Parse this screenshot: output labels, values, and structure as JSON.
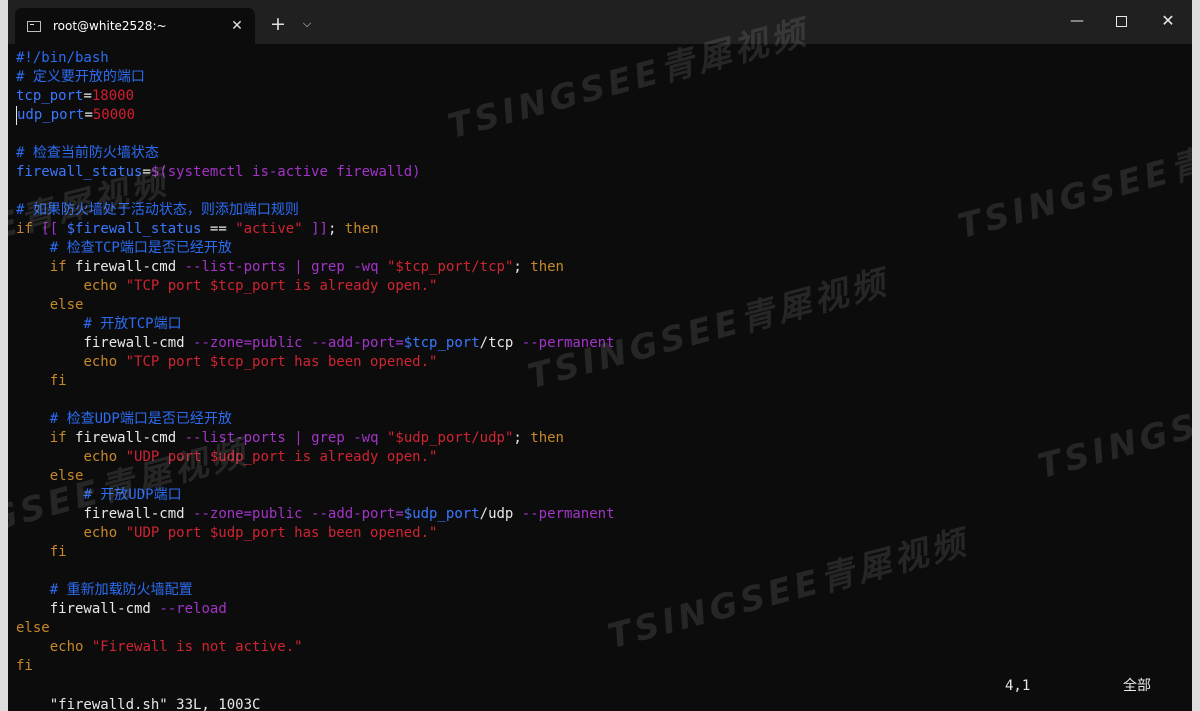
{
  "window": {
    "tab_title": "root@white2528:~",
    "tab_close": "✕",
    "new_tab": "+",
    "tab_dropdown": "⌵",
    "minimize": "—",
    "close": "✕"
  },
  "terminal": {
    "lines": [
      {
        "text": "#!/bin/bash"
      },
      {
        "text": "# 定义要开放的端口"
      },
      {
        "text": "tcp_port=18000"
      },
      {
        "text": "udp_port=50000"
      },
      {
        "text": ""
      },
      {
        "text": "# 检查当前防火墙状态"
      },
      {
        "text": "firewall_status=$(systemctl is-active firewalld)"
      },
      {
        "text": ""
      },
      {
        "text": "# 如果防火墙处于活动状态，则添加端口规则"
      },
      {
        "text": "if [[ $firewall_status == \"active\" ]]; then"
      },
      {
        "text": "    # 检查TCP端口是否已经开放"
      },
      {
        "text": "    if firewall-cmd --list-ports | grep -wq \"$tcp_port/tcp\"; then"
      },
      {
        "text": "        echo \"TCP port $tcp_port is already open.\""
      },
      {
        "text": "    else"
      },
      {
        "text": "        # 开放TCP端口"
      },
      {
        "text": "        firewall-cmd --zone=public --add-port=$tcp_port/tcp --permanent"
      },
      {
        "text": "        echo \"TCP port $tcp_port has been opened.\""
      },
      {
        "text": "    fi"
      },
      {
        "text": ""
      },
      {
        "text": "    # 检查UDP端口是否已经开放"
      },
      {
        "text": "    if firewall-cmd --list-ports | grep -wq \"$udp_port/udp\"; then"
      },
      {
        "text": "        echo \"UDP port $udp_port is already open.\""
      },
      {
        "text": "    else"
      },
      {
        "text": "        # 开放UDP端口"
      },
      {
        "text": "        firewall-cmd --zone=public --add-port=$udp_port/udp --permanent"
      },
      {
        "text": "        echo \"UDP port $udp_port has been opened.\""
      },
      {
        "text": "    fi"
      },
      {
        "text": ""
      },
      {
        "text": "    # 重新加载防火墙配置"
      },
      {
        "text": "    firewall-cmd --reload"
      },
      {
        "text": "else"
      },
      {
        "text": "    echo \"Firewall is not active.\""
      },
      {
        "text": "fi"
      }
    ]
  },
  "status": {
    "file_info": "\"firewalld.sh\" 33L, 1003C",
    "cursor_position": "4,1",
    "scroll_range": "全部"
  },
  "watermark": {
    "text": "TSINGSEE青犀视频"
  },
  "colors": {
    "comment": "#2b6cf2",
    "variable": "#3a78ff",
    "number": "#d31e2e",
    "keyword": "#c7882a",
    "option": "#a234c8",
    "string": "#cf2432",
    "background": "#0c0c0c"
  }
}
